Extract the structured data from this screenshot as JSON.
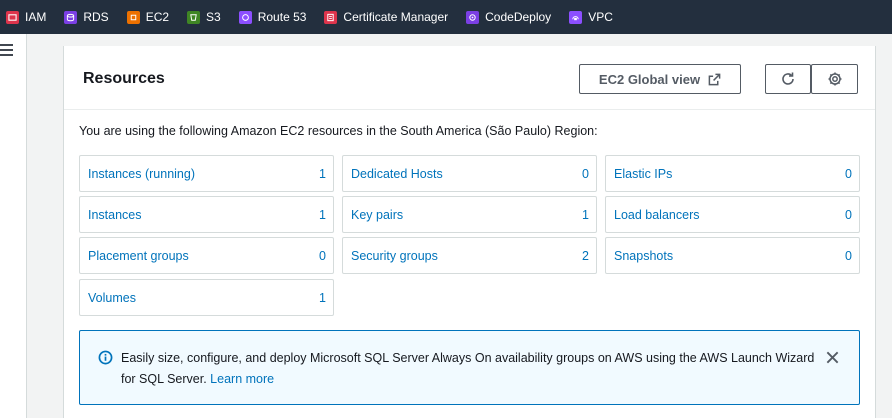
{
  "favorites": [
    {
      "label": "IAM",
      "color": "#dd344c",
      "icon": "iam-icon"
    },
    {
      "label": "RDS",
      "color": "#7b3fe4",
      "icon": "rds-icon"
    },
    {
      "label": "EC2",
      "color": "#ed7100",
      "icon": "ec2-icon"
    },
    {
      "label": "S3",
      "color": "#3f8624",
      "icon": "s3-icon"
    },
    {
      "label": "Route 53",
      "color": "#8c4fff",
      "icon": "route53-icon"
    },
    {
      "label": "Certificate Manager",
      "color": "#dd344c",
      "icon": "certificate-manager-icon"
    },
    {
      "label": "CodeDeploy",
      "color": "#7b3fe4",
      "icon": "codedeploy-icon"
    },
    {
      "label": "VPC",
      "color": "#8c4fff",
      "icon": "vpc-icon"
    }
  ],
  "resources": {
    "title": "Resources",
    "global_view_label": "EC2 Global view",
    "intro": "You are using the following Amazon EC2 resources in the South America (São Paulo) Region:",
    "items": [
      {
        "name": "Instances (running)",
        "count": "1"
      },
      {
        "name": "Dedicated Hosts",
        "count": "0"
      },
      {
        "name": "Elastic IPs",
        "count": "0"
      },
      {
        "name": "Instances",
        "count": "1"
      },
      {
        "name": "Key pairs",
        "count": "1"
      },
      {
        "name": "Load balancers",
        "count": "0"
      },
      {
        "name": "Placement groups",
        "count": "0"
      },
      {
        "name": "Security groups",
        "count": "2"
      },
      {
        "name": "Snapshots",
        "count": "0"
      },
      {
        "name": "Volumes",
        "count": "1"
      }
    ]
  },
  "info_banner": {
    "text": "Easily size, configure, and deploy Microsoft SQL Server Always On availability groups on AWS using the AWS Launch Wizard for SQL Server.",
    "link": "Learn more"
  },
  "colors": {
    "nav_bg": "#232f3e",
    "link": "#0073bb",
    "info_bg": "#f1faff"
  }
}
